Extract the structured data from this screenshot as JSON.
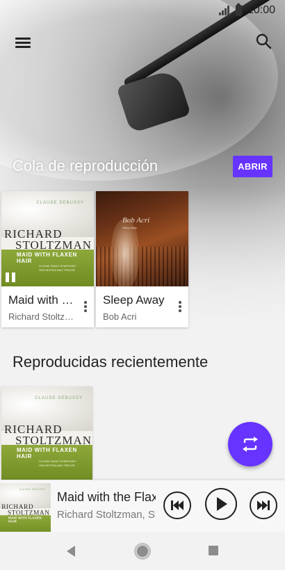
{
  "status_bar": {
    "time": "10:00"
  },
  "app_bar": {
    "menu_icon": "menu-icon",
    "search_icon": "search-icon"
  },
  "queue": {
    "title": "Cola de reproducción",
    "open_label": "ABRIR",
    "items": [
      {
        "title": "Maid with the Flaxen Hair",
        "title_display": "Maid with t...",
        "artist": "Richard Stoltzman",
        "artist_display": "Richard Stoltz...",
        "cover": {
          "composer": "CLAUDE DEBUSSY",
          "name_line1": "RICHARD",
          "name_line2": "STOLTZMAN",
          "subtitle": "MAID WITH FLAXEN HAIR",
          "credits": "SLOVAK RADIO SYMPHONY ORCHESTRA AND TREVOR"
        },
        "playing_badge": "pause-icon"
      },
      {
        "title": "Sleep Away",
        "artist": "Bob Acri",
        "cover": {
          "name": "Bob Acri",
          "credits": "Sleep Away"
        }
      }
    ]
  },
  "recent": {
    "title": "Reproducidas recientemente"
  },
  "fab": {
    "icon": "shuffle-repeat-icon",
    "color": "#6633ff"
  },
  "player": {
    "title": "Maid with the Flaxen Hair",
    "artist": "Richard Stoltzman, Slovak Radio Symphony Orchestra",
    "prev_icon": "skip-previous-icon",
    "play_icon": "play-icon",
    "next_icon": "skip-next-icon"
  },
  "colors": {
    "accent": "#6633ff"
  }
}
